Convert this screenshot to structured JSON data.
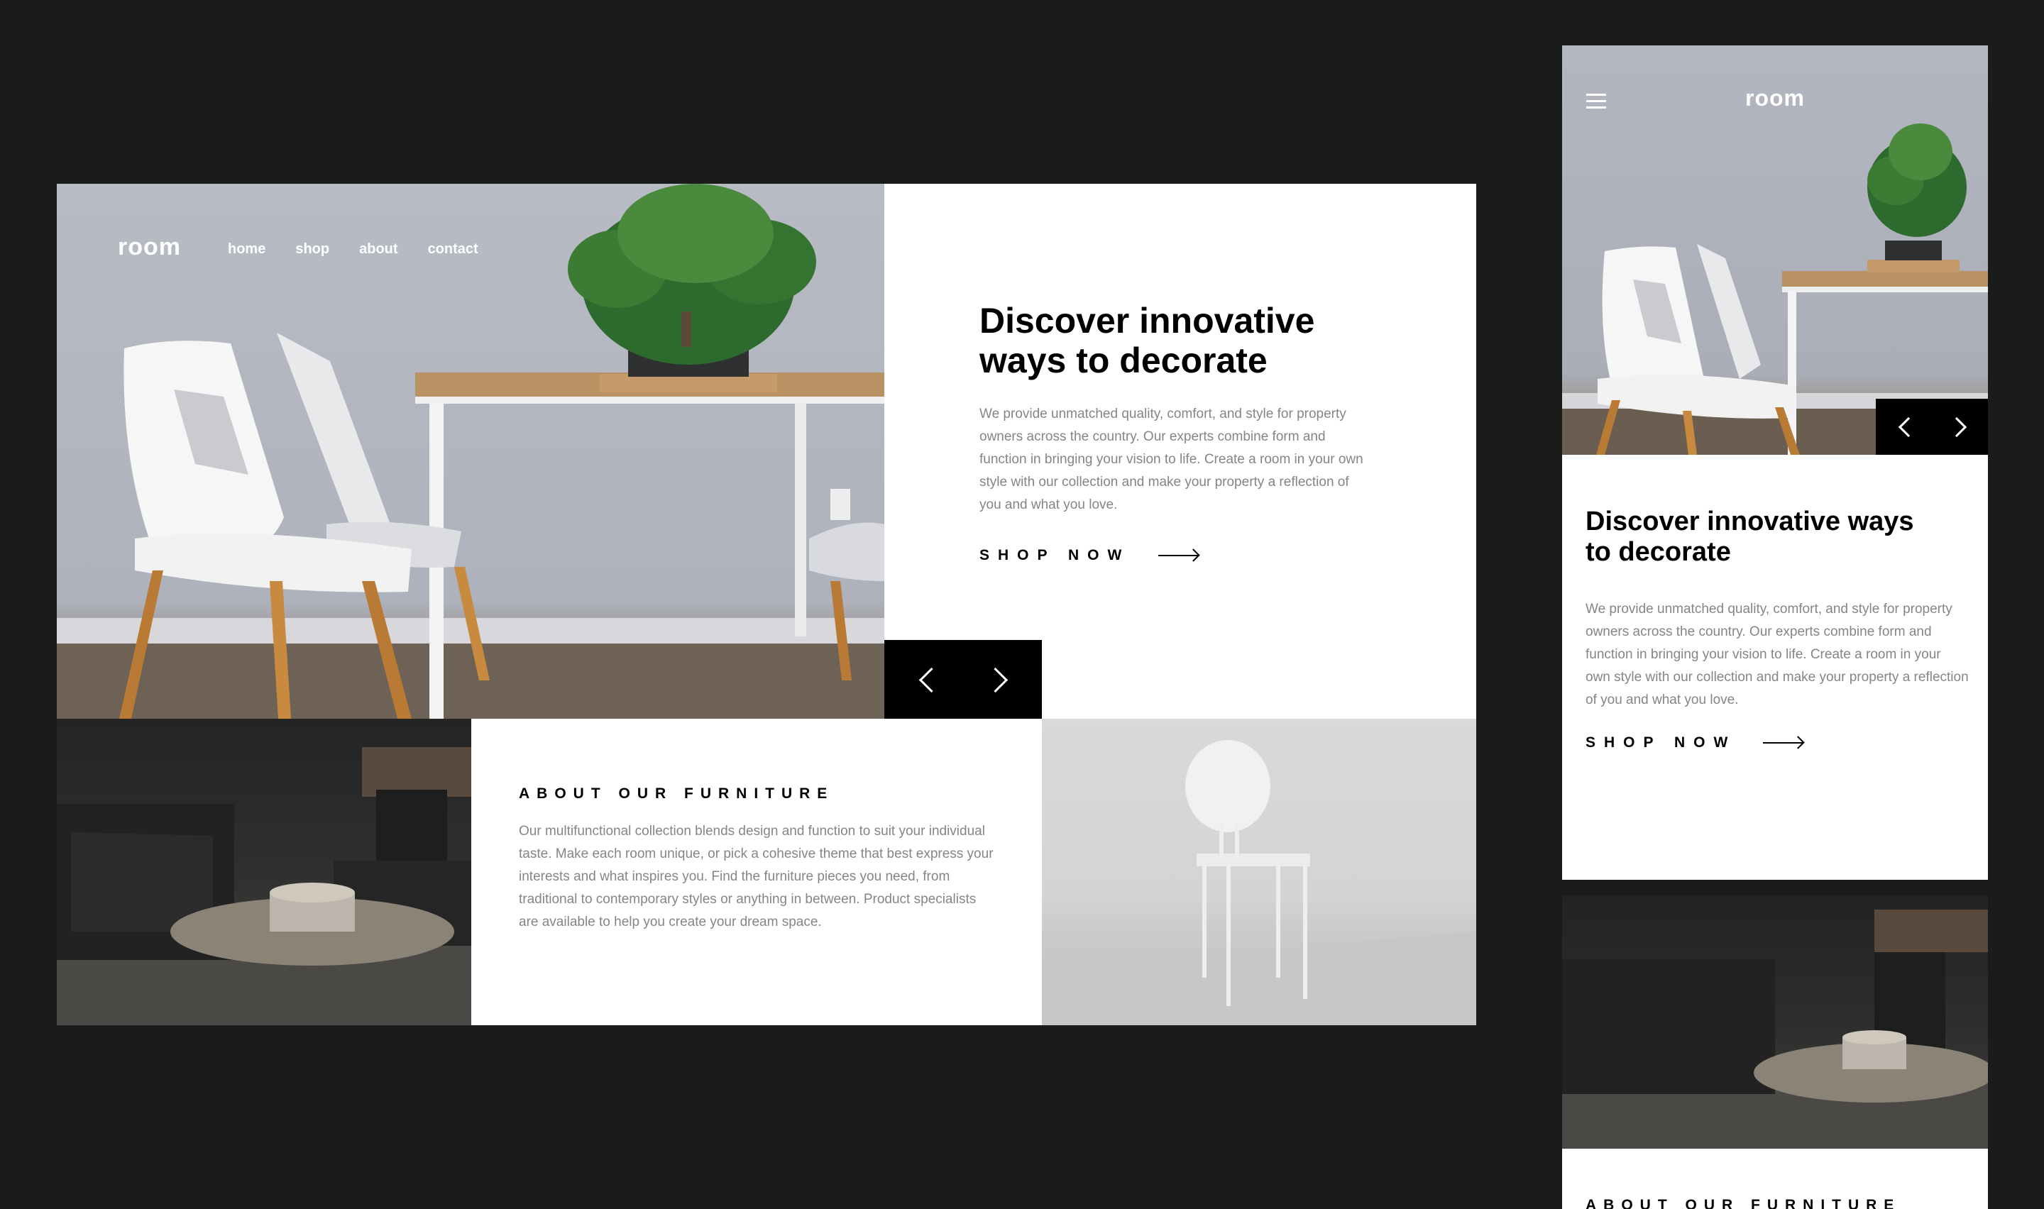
{
  "desktop": {
    "logo": "room",
    "nav": [
      "home",
      "shop",
      "about",
      "contact"
    ],
    "hero": {
      "title_line1": "Discover innovative",
      "title_line2": "ways to decorate",
      "copy": "We provide unmatched quality, comfort, and style for property owners across the country. Our experts combine form and function in bringing your vision to life. Create a room in your own style with our collection and make your property a reflection of you and what you love.",
      "cta": "SHOP NOW"
    },
    "about": {
      "title": "ABOUT OUR FURNITURE",
      "copy": "Our multifunctional collection blends design and function to suit your individual taste. Make each room unique, or pick a cohesive theme that best express your interests and what inspires you. Find the furniture pieces you need, from traditional to contemporary styles or anything in between. Product specialists are available to help you create your dream space."
    }
  },
  "mobile": {
    "logo": "room",
    "hero": {
      "title_line1": "Discover innovative ways",
      "title_line2": "to decorate",
      "copy": "We provide unmatched quality, comfort, and style for property owners across the country. Our experts combine form and function in bringing your vision to life. Create a room in your own style with our collection and make your property a reflection of you and what you love.",
      "cta": "SHOP NOW"
    },
    "about_title": "ABOUT OUR FURNITURE"
  },
  "icons": {
    "prev": "chevron-left-icon",
    "next": "chevron-right-icon",
    "menu": "hamburger-icon",
    "cta_arrow": "arrow-right-icon"
  },
  "colors": {
    "background": "#1a1c1c",
    "text_primary": "#000000",
    "text_muted": "#858585",
    "slider_bg": "#000000"
  }
}
